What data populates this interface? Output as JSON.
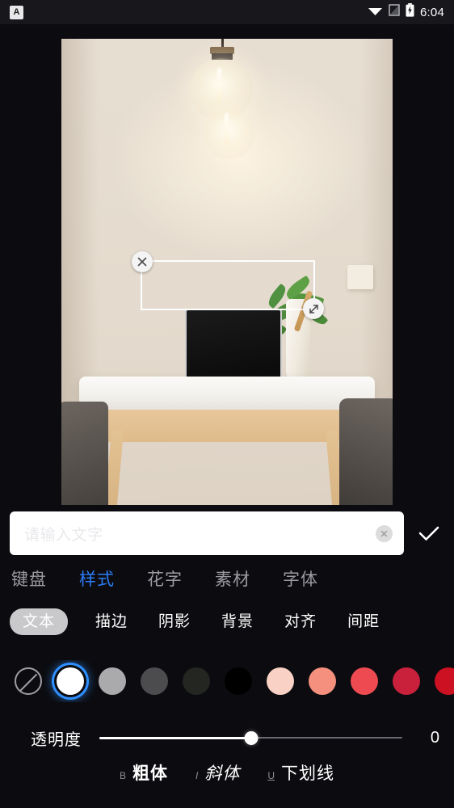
{
  "status_bar": {
    "app_badge": "A",
    "time": "6:04",
    "icons": [
      "wifi-icon",
      "signal-icon",
      "battery-charging-icon"
    ]
  },
  "canvas": {
    "photo_description": "desk-photo",
    "textbox": {
      "delete_icon": "close-icon",
      "resize_icon": "resize-handle-icon"
    }
  },
  "input": {
    "placeholder": "请输入文字",
    "value": "",
    "clear_icon": "clear-circle-icon",
    "confirm_icon": "check-icon"
  },
  "tabs": [
    {
      "label": "键盘",
      "active": false
    },
    {
      "label": "样式",
      "active": true
    },
    {
      "label": "花字",
      "active": false
    },
    {
      "label": "素材",
      "active": false
    },
    {
      "label": "字体",
      "active": false
    }
  ],
  "subtabs": [
    {
      "label": "文本",
      "active": true
    },
    {
      "label": "描边",
      "active": false
    },
    {
      "label": "阴影",
      "active": false
    },
    {
      "label": "背景",
      "active": false
    },
    {
      "label": "对齐",
      "active": false
    },
    {
      "label": "间距",
      "active": false
    }
  ],
  "swatches": [
    {
      "name": "none",
      "color": "transparent",
      "selected": false
    },
    {
      "name": "white",
      "color": "#ffffff",
      "selected": true
    },
    {
      "name": "light-gray",
      "color": "#aaaaad",
      "selected": false
    },
    {
      "name": "mid-gray",
      "color": "#4c4c4e",
      "selected": false
    },
    {
      "name": "dark-gray",
      "color": "#242622",
      "selected": false
    },
    {
      "name": "black",
      "color": "#000000",
      "selected": false
    },
    {
      "name": "pale-pink",
      "color": "#fad2c5",
      "selected": false
    },
    {
      "name": "salmon",
      "color": "#f4907d",
      "selected": false
    },
    {
      "name": "red",
      "color": "#ee4a51",
      "selected": false
    },
    {
      "name": "crimson",
      "color": "#c9203c",
      "selected": false
    },
    {
      "name": "dark-red",
      "color": "#cc1122",
      "selected": false
    }
  ],
  "slider": {
    "label": "透明度",
    "value": "0",
    "percent": 50
  },
  "format": [
    {
      "mark": "B",
      "label": "粗体",
      "style": "bold"
    },
    {
      "mark": "I",
      "label": "斜体",
      "style": "italic"
    },
    {
      "mark": "U",
      "label": "下划线",
      "style": "underline"
    }
  ],
  "theme": {
    "background": "#0c0c10",
    "accent": "#2b7cf6",
    "statusbar_bg": "#17171c"
  }
}
